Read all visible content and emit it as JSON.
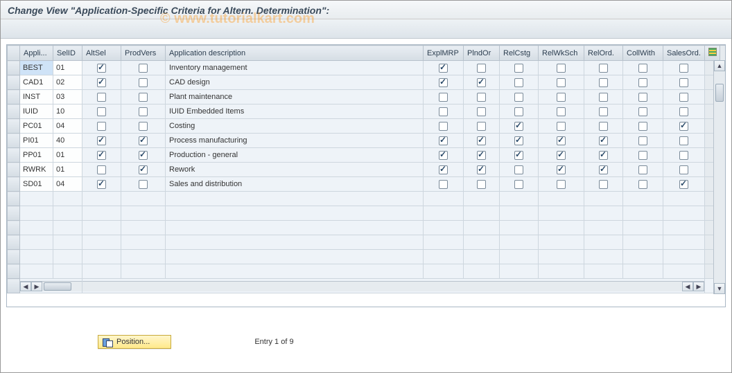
{
  "title": "Change View \"Application-Specific Criteria for Altern. Determination\":",
  "watermark": "© www.tutorialkart.com",
  "columns": {
    "appli": "Appli...",
    "selid": "SelID",
    "altsel": "AltSel",
    "prodvers": "ProdVers",
    "appdesc": "Application description",
    "explmrp": "ExplMRP",
    "plndor": "PlndOr",
    "relcstg": "RelCstg",
    "relwksch": "RelWkSch",
    "relord": "RelOrd.",
    "collwith": "CollWith",
    "salesord": "SalesOrd."
  },
  "rows": [
    {
      "app": "BEST",
      "sel": "01",
      "altsel": true,
      "prodvers": false,
      "desc": "Inventory management",
      "explmrp": true,
      "plndor": false,
      "relcstg": false,
      "relwksch": false,
      "relord": false,
      "collwith": false,
      "salesord": false
    },
    {
      "app": "CAD1",
      "sel": "02",
      "altsel": true,
      "prodvers": false,
      "desc": "CAD design",
      "explmrp": true,
      "plndor": true,
      "relcstg": false,
      "relwksch": false,
      "relord": false,
      "collwith": false,
      "salesord": false
    },
    {
      "app": "INST",
      "sel": "03",
      "altsel": false,
      "prodvers": false,
      "desc": "Plant maintenance",
      "explmrp": false,
      "plndor": false,
      "relcstg": false,
      "relwksch": false,
      "relord": false,
      "collwith": false,
      "salesord": false
    },
    {
      "app": "IUID",
      "sel": "10",
      "altsel": false,
      "prodvers": false,
      "desc": "IUID Embedded Items",
      "explmrp": false,
      "plndor": false,
      "relcstg": false,
      "relwksch": false,
      "relord": false,
      "collwith": false,
      "salesord": false
    },
    {
      "app": "PC01",
      "sel": "04",
      "altsel": false,
      "prodvers": false,
      "desc": "Costing",
      "explmrp": false,
      "plndor": false,
      "relcstg": true,
      "relwksch": false,
      "relord": false,
      "collwith": false,
      "salesord": true
    },
    {
      "app": "PI01",
      "sel": "40",
      "altsel": true,
      "prodvers": true,
      "desc": "Process manufacturing",
      "explmrp": true,
      "plndor": true,
      "relcstg": true,
      "relwksch": true,
      "relord": true,
      "collwith": false,
      "salesord": false
    },
    {
      "app": "PP01",
      "sel": "01",
      "altsel": true,
      "prodvers": true,
      "desc": "Production - general",
      "explmrp": true,
      "plndor": true,
      "relcstg": true,
      "relwksch": true,
      "relord": true,
      "collwith": false,
      "salesord": false
    },
    {
      "app": "RWRK",
      "sel": "01",
      "altsel": false,
      "prodvers": true,
      "desc": "Rework",
      "explmrp": true,
      "plndor": true,
      "relcstg": false,
      "relwksch": true,
      "relord": true,
      "collwith": false,
      "salesord": false
    },
    {
      "app": "SD01",
      "sel": "04",
      "altsel": true,
      "prodvers": false,
      "desc": "Sales and distribution",
      "explmrp": false,
      "plndor": false,
      "relcstg": false,
      "relwksch": false,
      "relord": false,
      "collwith": false,
      "salesord": true
    }
  ],
  "empty_rows": 6,
  "position_button": "Position...",
  "entry_text": "Entry 1 of 9"
}
